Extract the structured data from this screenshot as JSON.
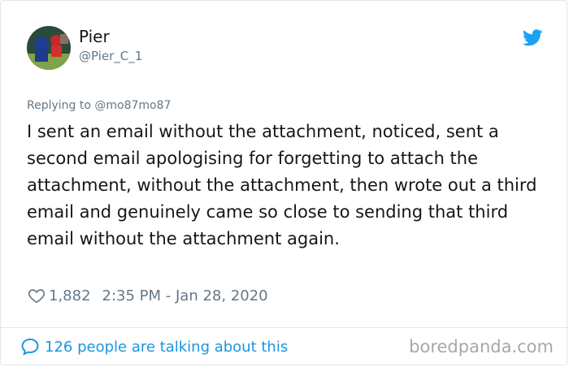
{
  "author": {
    "name": "Pier",
    "handle": "@Pier_C_1"
  },
  "reply": {
    "label": "Replying to @mo87mo87"
  },
  "tweet": {
    "text": "I sent an email without the attachment, noticed, sent a second email apologising for forgetting to attach the attachment, without the attachment, then wrote out a third email and genuinely came so close to sending that third email without the attachment again."
  },
  "stats": {
    "likes": "1,882",
    "timestamp": "2:35 PM - Jan 28, 2020"
  },
  "footer": {
    "talking_label": "126 people are talking about this",
    "watermark": "boredpanda.com"
  },
  "icons": {
    "brand": "twitter-bird-icon",
    "like": "heart-icon",
    "conversation": "speech-bubble-icon"
  },
  "colors": {
    "twitter_blue": "#1da1f2",
    "link_blue": "#1b95e0",
    "secondary_text": "#657786",
    "primary_text": "#14171a",
    "border": "#e1e8ed"
  }
}
